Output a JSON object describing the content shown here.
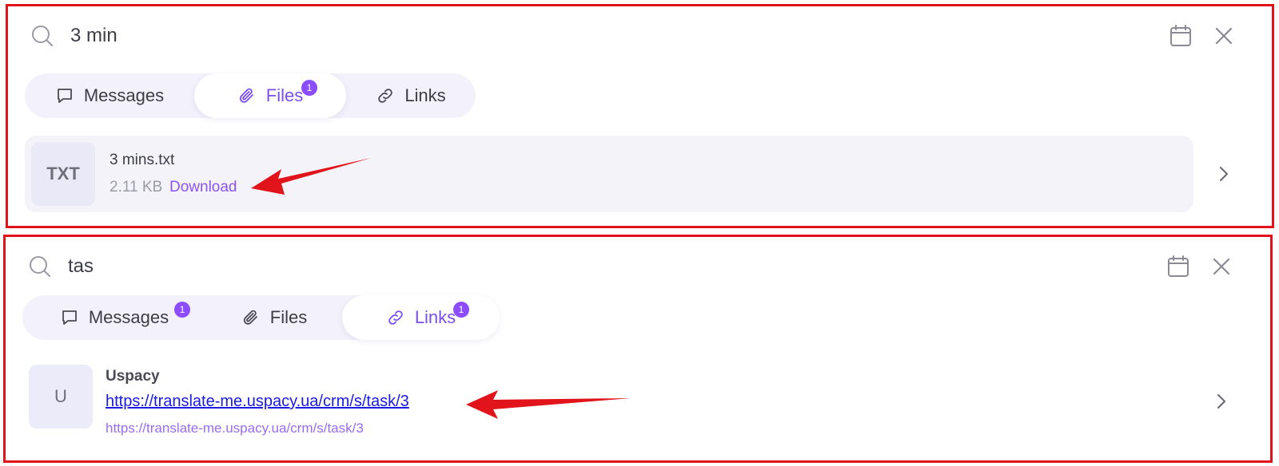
{
  "panel1": {
    "search": {
      "query": "3 min"
    },
    "tabs": [
      {
        "label": "Messages",
        "icon": "chat-bubble-icon",
        "active": false,
        "badge": ""
      },
      {
        "label": "Files",
        "icon": "paperclip-icon",
        "active": true,
        "badge": "1"
      },
      {
        "label": "Links",
        "icon": "link-icon",
        "active": false,
        "badge": ""
      }
    ],
    "result": {
      "thumb_label": "TXT",
      "file_name": "3 mins.txt",
      "file_size": "2.11 KB",
      "download_label": "Download"
    }
  },
  "panel2": {
    "search": {
      "query": "tas"
    },
    "tabs": [
      {
        "label": "Messages",
        "icon": "chat-bubble-icon",
        "active": false,
        "badge": "1"
      },
      {
        "label": "Files",
        "icon": "paperclip-icon",
        "active": false,
        "badge": ""
      },
      {
        "label": "Links",
        "icon": "link-icon",
        "active": true,
        "badge": "1"
      }
    ],
    "result": {
      "thumb_label": "U",
      "title": "Uspacy",
      "url": "https://translate-me.uspacy.ua/crm/s/task/3",
      "sub_url": "https://translate-me.uspacy.ua/crm/s/task/3"
    }
  },
  "colors": {
    "accent": "#8b4dff",
    "annotation": "#e1141b",
    "link": "#1a1ae0"
  }
}
